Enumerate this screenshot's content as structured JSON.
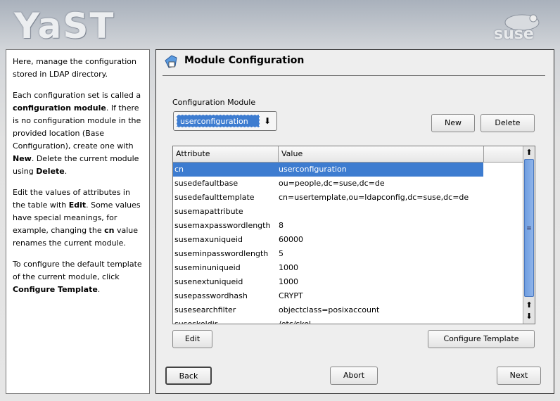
{
  "header": {
    "logo": "YaST",
    "brand": "suse"
  },
  "help": {
    "paragraphs": [
      "Here, manage the configuration stored in LDAP directory.",
      "Each configuration set is called a <b>configuration module</b>. If there is no configuration module in the provided location (Base Configuration), create one with <b>New</b>. Delete the current module using <b>Delete</b>.",
      "Edit the values of attributes in the table with <b>Edit</b>. Some values have special meanings, for example, changing the <b>cn</b> value renames the current module.",
      "To configure the default template of the current module, click <b>Configure Template</b>."
    ]
  },
  "main": {
    "title": "Module Configuration",
    "combo_label": "Configuration Module",
    "combo_value": "userconfiguration",
    "new_label": "New",
    "delete_label": "Delete",
    "edit_label": "Edit",
    "configure_template_label": "Configure Template",
    "table": {
      "columns": [
        "Attribute",
        "Value"
      ],
      "rows": [
        {
          "attr": "cn",
          "value": "userconfiguration",
          "selected": true
        },
        {
          "attr": "susedefaultbase",
          "value": "ou=people,dc=suse,dc=de"
        },
        {
          "attr": "susedefaulttemplate",
          "value": "cn=usertemplate,ou=ldapconfig,dc=suse,dc=de"
        },
        {
          "attr": "susemapattribute",
          "value": ""
        },
        {
          "attr": "susemaxpasswordlength",
          "value": "8"
        },
        {
          "attr": "susemaxuniqueid",
          "value": "60000"
        },
        {
          "attr": "suseminpasswordlength",
          "value": "5"
        },
        {
          "attr": "suseminuniqueid",
          "value": "1000"
        },
        {
          "attr": "susenextuniqueid",
          "value": "1000"
        },
        {
          "attr": "susepasswordhash",
          "value": "CRYPT"
        },
        {
          "attr": "susesearchfilter",
          "value": "objectclass=posixaccount"
        },
        {
          "attr": "suseskeldir",
          "value": "/etc/skel"
        }
      ]
    }
  },
  "footer": {
    "back": "Back",
    "abort": "Abort",
    "next": "Next"
  }
}
